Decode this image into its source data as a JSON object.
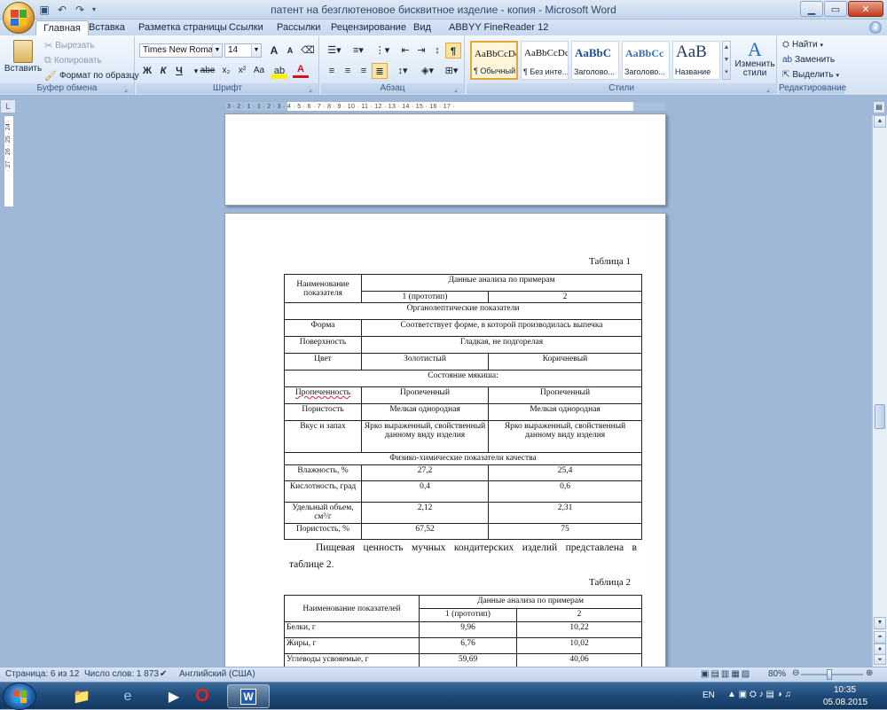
{
  "window": {
    "title": "патент на безглютеновое бисквитное изделие - копия - Microsoft Word"
  },
  "qat": {
    "save_icon": "save-icon",
    "undo_icon": "undo-icon",
    "redo_icon": "redo-icon"
  },
  "tabs": [
    "Главная",
    "Вставка",
    "Разметка страницы",
    "Ссылки",
    "Рассылки",
    "Рецензирование",
    "Вид",
    "ABBYY FineReader 12"
  ],
  "ribbon": {
    "clipboard": {
      "label": "Буфер обмена",
      "paste": "Вставить",
      "cut": "Вырезать",
      "copy": "Копировать",
      "format_painter": "Формат по образцу"
    },
    "font": {
      "label": "Шрифт",
      "font_name": "Times New Roman",
      "font_size": "14",
      "bold": "Ж",
      "italic": "К",
      "underline": "Ч",
      "strike": "abe",
      "subscript": "x₂",
      "superscript": "x²",
      "change_case": "Aa",
      "grow": "A",
      "shrink": "A"
    },
    "paragraph": {
      "label": "Абзац",
      "pilcrow": "¶"
    },
    "styles": {
      "label": "Стили",
      "items": [
        {
          "preview": "AaBbCcDc",
          "name": "¶ Обычный",
          "selected": true
        },
        {
          "preview": "AaBbCcDc",
          "name": "¶ Без инте...",
          "selected": false
        },
        {
          "preview": "AaBbC",
          "name": "Заголово...",
          "selected": false
        },
        {
          "preview": "AaBbCc",
          "name": "Заголово...",
          "selected": false
        },
        {
          "preview": "AaB",
          "name": "Название",
          "selected": false
        }
      ],
      "change_styles": "Изменить стили"
    },
    "editing": {
      "label": "Редактирование",
      "find": "Найти",
      "replace": "Заменить",
      "select": "Выделить"
    }
  },
  "ruler": {
    "h_ticks": "3 · 2 · 1 · 1 · 2 · 3 · 4 · 5 · 6 · 7 · 8 · 9 · 10 · 11 · 12 · 13 · 14 · 15 · 16 · 17 ·",
    "v_ticks": "· 27 · 26 · 25 · 24 ·"
  },
  "document": {
    "table1": {
      "caption": "Таблица 1",
      "header": {
        "col1": "Наименование показателя",
        "span": "Данные анализа по примерам",
        "sub1": "1 (прототип)",
        "sub2": "2"
      },
      "section1": "Органолептические показатели",
      "rows_a": [
        {
          "name": "Форма",
          "merged": "Соответствует форме, в которой производилась выпечка"
        },
        {
          "name": "Поверхность",
          "merged": "Гладкая, не подгорелая"
        }
      ],
      "row_color": {
        "name": "Цвет",
        "v1": "Золотистый",
        "v2": "Коричневый"
      },
      "section2": "Состояние мякиша:",
      "rows_b": [
        {
          "name": "Пропеченность",
          "v1": "Пропеченный",
          "v2": "Пропеченный"
        },
        {
          "name": "Пористость",
          "v1": "Мелкая однородная",
          "v2": "Мелкая однородная"
        },
        {
          "name": "Вкус и запах",
          "v1": "Ярко выраженный, свойственный данному виду изделия",
          "v2": "Ярко выраженный, свойственный данному виду изделия"
        }
      ],
      "section3": "Физико-химические показатели качества",
      "rows_c": [
        {
          "name": "Влажность, %",
          "v1": "27,2",
          "v2": "25,4"
        },
        {
          "name": "Кислотность, град",
          "v1": "0,4",
          "v2": "0,6"
        },
        {
          "name": "Удельный объем, см³/г",
          "v1": "2,12",
          "v2": "2,31"
        },
        {
          "name": "Пористость, %",
          "v1": "67,52",
          "v2": "75"
        }
      ]
    },
    "paragraph": "Пищевая ценность мучных кондитерских изделий представлена в таблице 2.",
    "table2": {
      "caption": "Таблица 2",
      "header": {
        "col1": "Наименование показателей",
        "span": "Данные анализа по примерам",
        "sub1": "1 (прототип)",
        "sub2": "2"
      },
      "rows": [
        {
          "name": "Белки, г",
          "v1": "9,96",
          "v2": "10,22"
        },
        {
          "name": "Жиры, г",
          "v1": "6,76",
          "v2": "10,02"
        },
        {
          "name": "Углеводы усвояемые, г",
          "v1": "59,69",
          "v2": "40,06"
        }
      ]
    }
  },
  "status": {
    "page": "Страница: 6 из 12",
    "words": "Число слов: 1 873",
    "language": "Английский (США)",
    "zoom": "80%"
  },
  "taskbar": {
    "lang": "EN",
    "time": "10:35",
    "date": "05.08.2015"
  }
}
